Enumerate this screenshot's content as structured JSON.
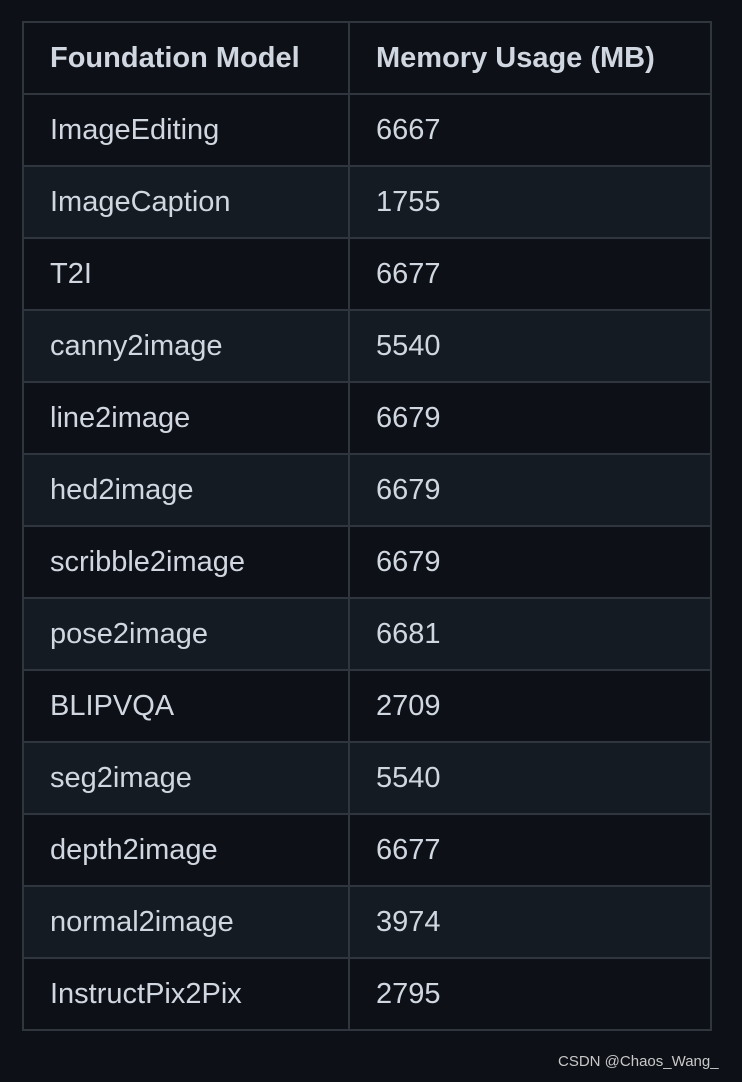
{
  "table": {
    "headers": [
      "Foundation Model",
      "Memory Usage (MB)"
    ],
    "rows": [
      [
        "ImageEditing",
        "6667"
      ],
      [
        "ImageCaption",
        "1755"
      ],
      [
        "T2I",
        "6677"
      ],
      [
        "canny2image",
        "5540"
      ],
      [
        "line2image",
        "6679"
      ],
      [
        "hed2image",
        "6679"
      ],
      [
        "scribble2image",
        "6679"
      ],
      [
        "pose2image",
        "6681"
      ],
      [
        "BLIPVQA",
        "2709"
      ],
      [
        "seg2image",
        "5540"
      ],
      [
        "depth2image",
        "6677"
      ],
      [
        "normal2image",
        "3974"
      ],
      [
        "InstructPix2Pix",
        "2795"
      ]
    ]
  },
  "watermark": "CSDN @Chaos_Wang_",
  "colors": {
    "background": "#0d1117",
    "row_alt": "#151b23",
    "border": "#30363d",
    "text": "#d1d7e0"
  }
}
